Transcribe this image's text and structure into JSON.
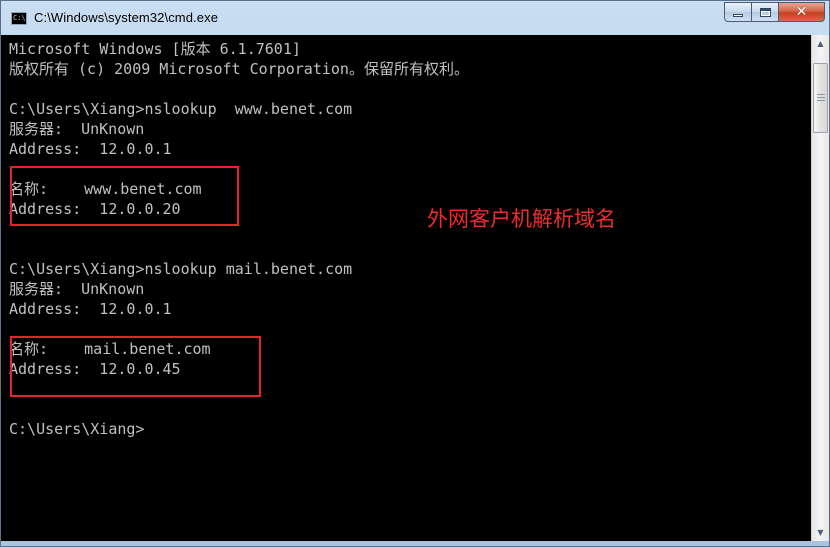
{
  "window": {
    "title": "C:\\Windows\\system32\\cmd.exe",
    "icon": "cmd-icon",
    "icon_text": "C:\\"
  },
  "controls": {
    "minimize_icon": "minimize-icon",
    "maximize_icon": "maximize-icon",
    "close_icon": "close-icon",
    "close_glyph": "✕"
  },
  "console": {
    "lines": [
      "Microsoft Windows [版本 6.1.7601]",
      "版权所有 (c) 2009 Microsoft Corporation。保留所有权利。",
      "",
      "C:\\Users\\Xiang>nslookup  www.benet.com",
      "服务器:  UnKnown",
      "Address:  12.0.0.1",
      "",
      "名称:    www.benet.com",
      "Address:  12.0.0.20",
      "",
      "",
      "C:\\Users\\Xiang>nslookup mail.benet.com",
      "服务器:  UnKnown",
      "Address:  12.0.0.1",
      "",
      "名称:    mail.benet.com",
      "Address:  12.0.0.45",
      "",
      "",
      "C:\\Users\\Xiang>"
    ],
    "text_color": "#c0c0c0",
    "background": "#000000"
  },
  "annotation": {
    "text": "外网客户机解析域名",
    "color": "#ef2a2a"
  },
  "scrollbar": {
    "up_arrow": "▲",
    "down_arrow": "▼"
  }
}
